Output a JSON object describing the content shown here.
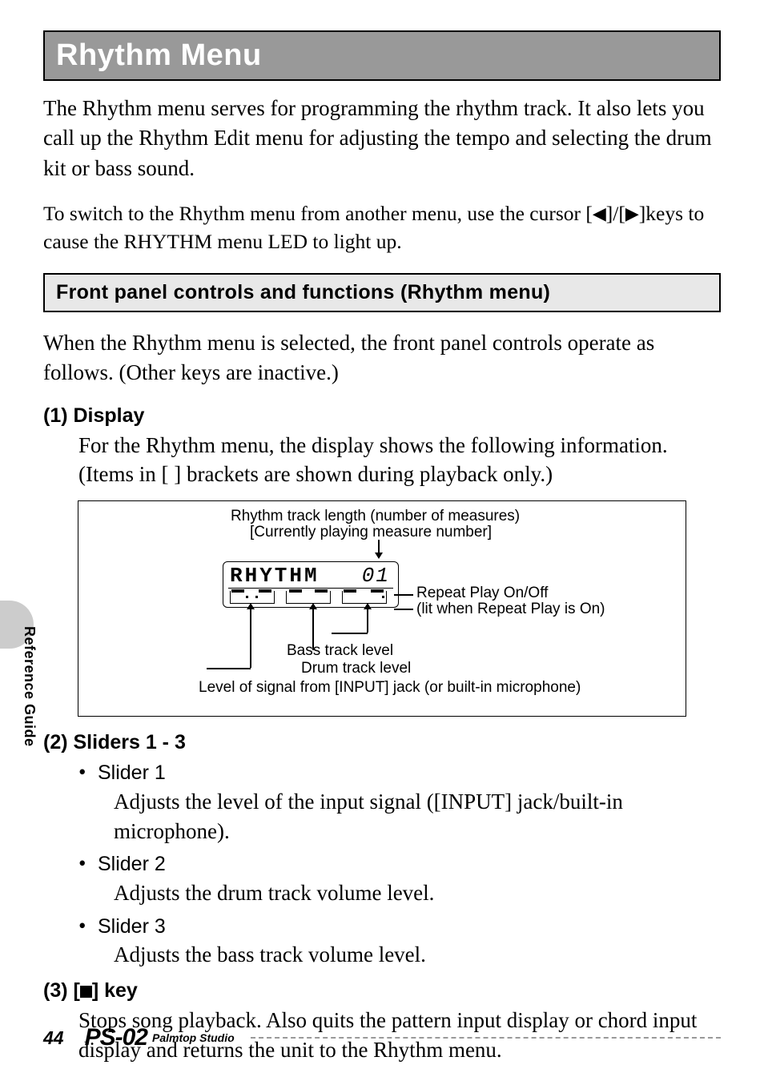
{
  "title": "Rhythm Menu",
  "intro_p1": "The Rhythm menu serves for programming the rhythm track. It also lets you call up the Rhythm Edit menu for adjusting the tempo and selecting the drum kit or bass sound.",
  "intro_p2_a": "To switch to the Rhythm menu from another menu, use the cursor [",
  "intro_p2_b": "]/[",
  "intro_p2_c": "]keys to cause the RHYTHM menu LED to light up.",
  "subhead": "Front panel controls and functions (Rhythm menu)",
  "para_after_subhead": "When the Rhythm menu is selected, the front panel controls operate as follows. (Other keys are inactive.)",
  "items": {
    "i1": {
      "head": "(1) Display",
      "body": "For the Rhythm menu, the display shows the following information. (Items in [  ] brackets are shown during playback only.)"
    },
    "i2": {
      "head": "(2) Sliders 1 - 3"
    },
    "i3": {
      "head": "(3) [",
      "head_suffix": "] key",
      "body": "Stops song playback. Also quits the pattern input display or chord input display and returns the unit to the Rhythm menu."
    }
  },
  "sliders": {
    "s1": {
      "name": "Slider 1",
      "desc": "Adjusts the level of the input signal ([INPUT] jack/built-in microphone)."
    },
    "s2": {
      "name": "Slider 2",
      "desc": "Adjusts the drum track volume level."
    },
    "s3": {
      "name": "Slider 3",
      "desc": "Adjusts the bass track volume level."
    }
  },
  "diagram": {
    "top1": "Rhythm track length (number of measures)",
    "top2": "[Currently playing measure number]",
    "lcd_text": "RHYTHM",
    "lcd_num": "01",
    "right1": "Repeat Play On/Off",
    "right2": "(lit when Repeat Play is On)",
    "mid1": "Bass track level",
    "mid2": "Drum track level",
    "bottom": "Level of signal from [INPUT] jack (or built-in microphone)"
  },
  "side_tab": "Reference Guide",
  "footer": {
    "page": "44",
    "logo": "PS-02",
    "logo_sub": "Palmtop Studio"
  }
}
